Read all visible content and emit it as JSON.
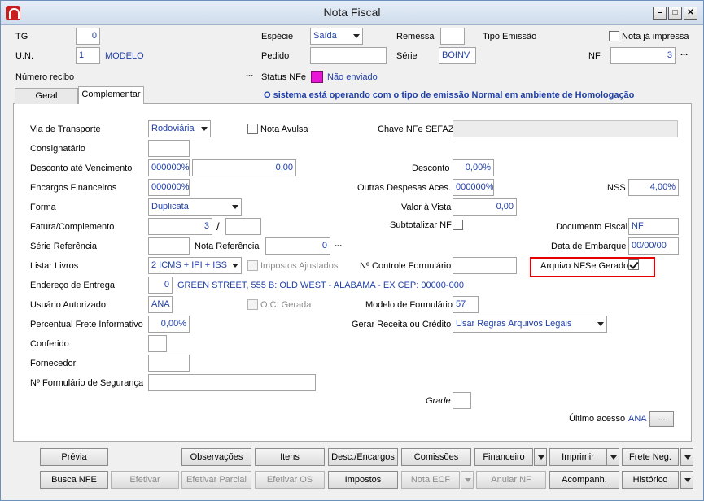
{
  "window": {
    "title": "Nota Fiscal",
    "controls": [
      "minimize",
      "maximize",
      "close"
    ]
  },
  "header": {
    "tg_label": "TG",
    "tg_value": "0",
    "un_label": "U.N.",
    "un_value": "1",
    "un_name": "MODELO",
    "especie_label": "Espécie",
    "especie_value": "Saída",
    "remessa_label": "Remessa",
    "remessa_value": "",
    "tipo_emissao_label": "Tipo Emissão",
    "nota_impressa_label": "Nota já impressa",
    "pedido_label": "Pedido",
    "pedido_value": "",
    "serie_label": "Série",
    "serie_value": "BOINV",
    "nf_label": "NF",
    "nf_value": "3",
    "numero_recibo_label": "Número recibo",
    "ellipsis": "...",
    "status_nfe_label": "Status NFe",
    "status_nfe_value": "Não enviado",
    "status_color": "#e815d6",
    "banner": "O sistema está operando com o tipo de emissão Normal em ambiente de Homologação"
  },
  "tabs": [
    {
      "label": "Geral",
      "active": false
    },
    {
      "label": "Complementar",
      "active": true
    }
  ],
  "form": {
    "via_transporte_label": "Via de Transporte",
    "via_transporte_value": "Rodoviária",
    "nota_avulsa_label": "Nota Avulsa",
    "chave_nfe_label": "Chave NFe SEFAZ",
    "chave_nfe_value": "",
    "consignatario_label": "Consignatário",
    "consignatario_value": "",
    "desconto_venc_label": "Desconto até Vencimento",
    "desconto_venc_pct": "000000%",
    "desconto_venc_value": "0,00",
    "desconto_label": "Desconto",
    "desconto_value": "0,00%",
    "encargos_label": "Encargos Financeiros",
    "encargos_value": "000000%",
    "outras_despesas_label": "Outras Despesas Aces.",
    "outras_despesas_value": "000000%",
    "inss_label": "INSS",
    "inss_value": "4,00%",
    "forma_label": "Forma",
    "forma_value": "Duplicata",
    "valor_vista_label": "Valor à Vista",
    "valor_vista_value": "0,00",
    "fatura_label": "Fatura/Complemento",
    "fatura_value": "3",
    "fatura_sep": "/",
    "fatura_compl": "",
    "subtotalizar_label": "Subtotalizar NF",
    "documento_fiscal_label": "Documento Fiscal",
    "documento_fiscal_value": "NF",
    "serie_ref_label": "Série Referência",
    "serie_ref_value": "",
    "nota_ref_label": "Nota Referência",
    "nota_ref_value": "0",
    "data_embarque_label": "Data de Embarque",
    "data_embarque_value": "00/00/00",
    "listar_livros_label": "Listar Livros",
    "listar_livros_value": "2 ICMS + IPI + ISS",
    "impostos_ajustados_label": "Impostos Ajustados",
    "controle_form_label": "Nº Controle Formulário",
    "controle_form_value": "",
    "arquivo_nfse_label": "Arquivo NFSe Gerado",
    "arquivo_nfse_checked": true,
    "endereco_label": "Endereço de Entrega",
    "endereco_code": "0",
    "endereco_text": "GREEN STREET, 555 B: OLD WEST - ALABAMA - EX CEP: 00000-000",
    "usuario_label": "Usuário Autorizado",
    "usuario_value": "ANA",
    "oc_gerada_label": "O.C. Gerada",
    "modelo_form_label": "Modelo de Formulário",
    "modelo_form_value": "57",
    "frete_label": "Percentual Frete Informativo",
    "frete_value": "0,00%",
    "gerar_receita_label": "Gerar Receita ou Crédito",
    "gerar_receita_value": "Usar Regras Arquivos Legais",
    "conferido_label": "Conferido",
    "conferido_value": "",
    "fornecedor_label": "Fornecedor",
    "fornecedor_value": "",
    "form_seguranca_label": "Nº Formulário de Segurança",
    "form_seguranca_value": "",
    "grade_label": "Grade",
    "ultimo_acesso_label": "Último acesso",
    "ultimo_acesso_value": "ANA",
    "ultimo_acesso_btn": "..."
  },
  "buttons_row1": [
    {
      "label": "Prévia",
      "enabled": true
    },
    {
      "label": "Observações",
      "enabled": true
    },
    {
      "label": "Itens",
      "enabled": true
    },
    {
      "label": "Desc./Encargos",
      "enabled": true
    },
    {
      "label": "Comissões",
      "enabled": true
    },
    {
      "label": "Financeiro",
      "enabled": true
    },
    {
      "label": "Imprimir",
      "enabled": true
    },
    {
      "label": "Frete Neg.",
      "enabled": true
    }
  ],
  "buttons_row2": [
    {
      "label": "Busca NFE",
      "enabled": true
    },
    {
      "label": "Efetivar",
      "enabled": false
    },
    {
      "label": "Efetivar Parcial",
      "enabled": false
    },
    {
      "label": "Efetivar OS",
      "enabled": false
    },
    {
      "label": "Impostos",
      "enabled": true
    },
    {
      "label": "Nota ECF",
      "enabled": false
    },
    {
      "label": "Anular NF",
      "enabled": false
    },
    {
      "label": "Acompanh.",
      "enabled": true
    },
    {
      "label": "Histórico",
      "enabled": true
    }
  ]
}
